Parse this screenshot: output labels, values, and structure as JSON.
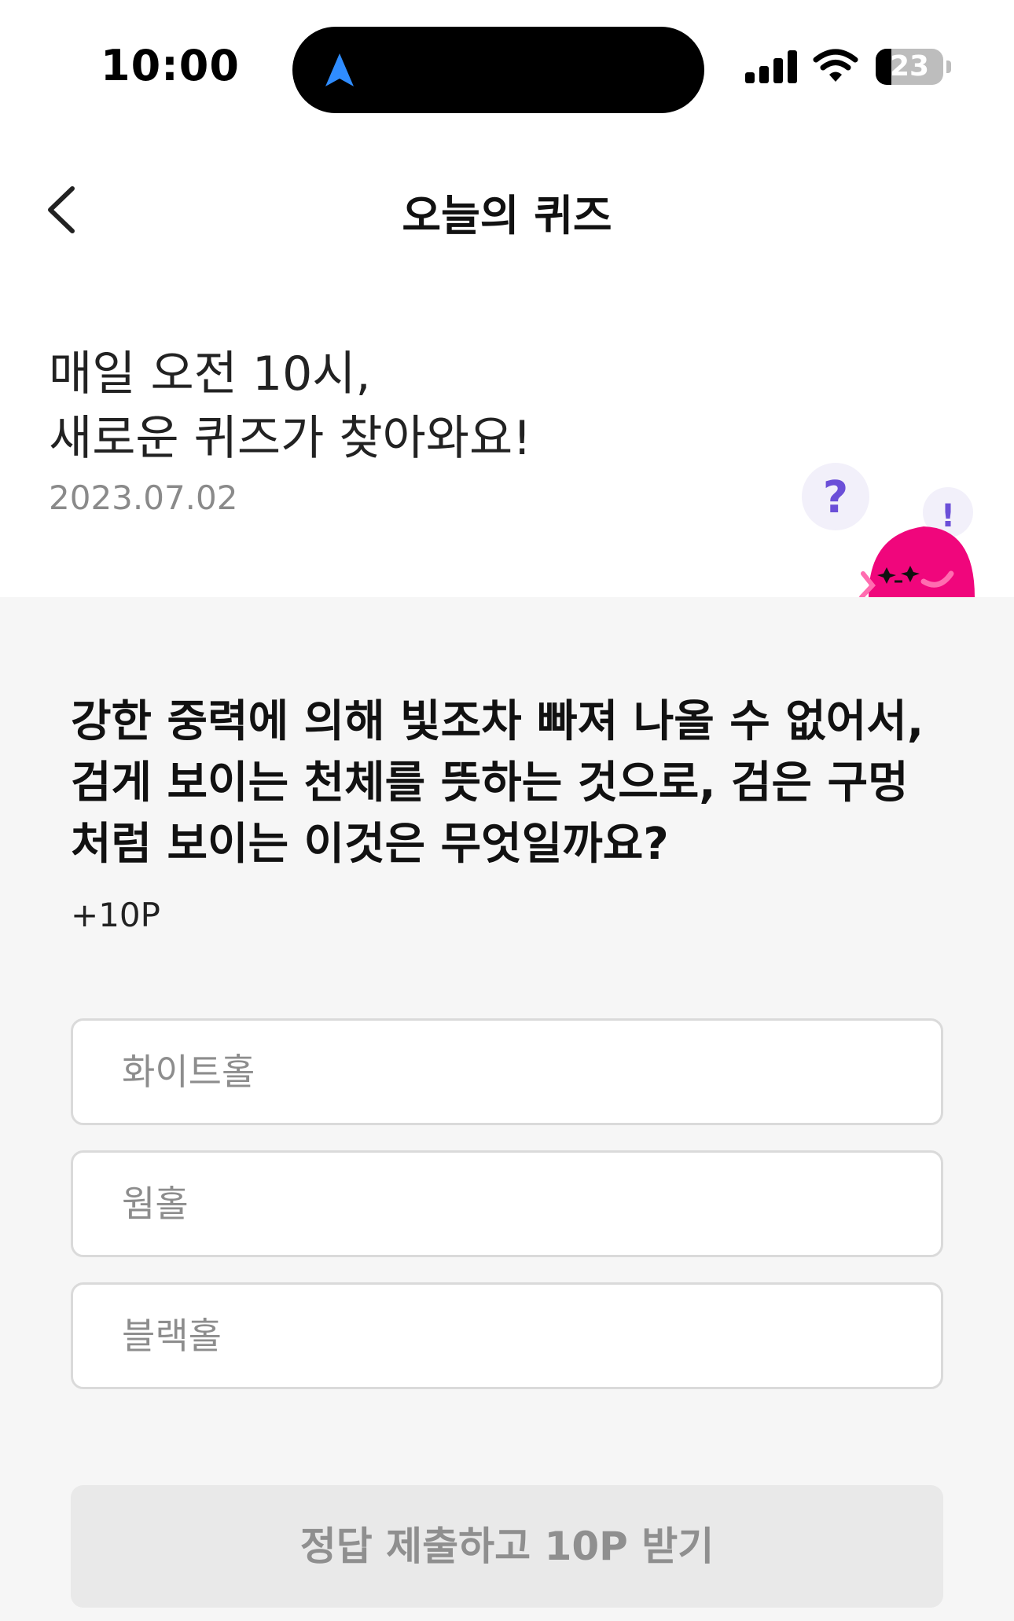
{
  "status_bar": {
    "time": "10:00",
    "battery_level": "23",
    "battery_percent": 23,
    "icons": [
      "navigation-arrow-icon",
      "signal-icon",
      "wifi-icon",
      "battery-icon"
    ],
    "nav_arrow_color": "#2f8cff"
  },
  "header": {
    "title": "오늘의 퀴즈",
    "back_icon": "chevron-left-icon"
  },
  "intro": {
    "line1": "매일 오전 10시,",
    "line2": "새로운 퀴즈가 찾아와요!",
    "date": "2023.07.02"
  },
  "mascot": {
    "question_mark": "?",
    "exclamation_mark": "!",
    "color": "#f0067c"
  },
  "quiz": {
    "question": "강한 중력에 의해 빛조차 빠져 나올 수 없어서, 검게 보이는 천체를 뜻하는 것으로, 검은 구멍처럼 보이는 이것은 무엇일까요?",
    "points": "+10P",
    "options": [
      {
        "label": "화이트홀"
      },
      {
        "label": "웜홀"
      },
      {
        "label": "블랙홀"
      }
    ],
    "submit_label": "정답 제출하고 10P 받기"
  },
  "colors": {
    "content_background": "#f6f6f6",
    "submit_disabled_bg": "#e9e9e9",
    "option_border": "#dadada"
  }
}
